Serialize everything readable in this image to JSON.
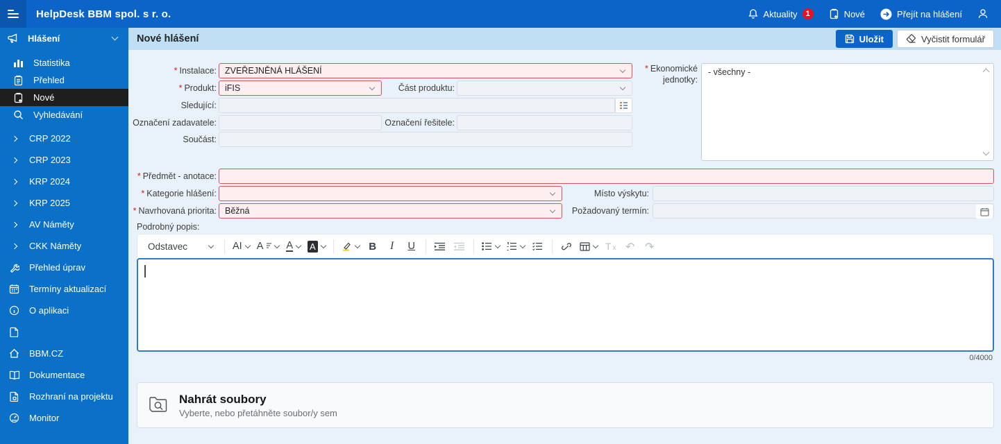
{
  "colors": {
    "brand": "#0d64c8",
    "hamburger": "#0b57b0",
    "sidebar-bg": "#0a70c8",
    "active-bg": "#1e1e1e",
    "header-bg": "#bfe0f4",
    "main-bg": "#e9f2fa",
    "req-border": "#d9545e",
    "req-bg": "#fdeef0",
    "field-bg": "#eff3f7",
    "field-border": "#d7dde3",
    "editor-border": "#2f7ad0",
    "badge": "#e81123"
  },
  "topbar": {
    "title": "HelpDesk BBM spol. s r. o.",
    "aktuality_label": "Aktuality",
    "aktuality_badge": "1",
    "nove_label": "Nové",
    "prejit_label": "Přejít na hlášení"
  },
  "sidebar": {
    "section_label": "Hlášení",
    "items": [
      {
        "label": "Statistika"
      },
      {
        "label": "Přehled"
      },
      {
        "label": "Nové"
      },
      {
        "label": "Vyhledávání"
      }
    ],
    "groups": [
      "CRP 2022",
      "CRP 2023",
      "KRP 2024",
      "KRP 2025",
      "AV Náměty",
      "CKK Náměty"
    ],
    "links": [
      {
        "label": "Přehled úprav"
      },
      {
        "label": "Termíny aktualizací"
      },
      {
        "label": "O aplikaci"
      },
      {
        "label": ""
      },
      {
        "label": "BBM.CZ"
      },
      {
        "label": "Dokumentace"
      },
      {
        "label": "Rozhraní na projektu"
      },
      {
        "label": "Monitor"
      }
    ]
  },
  "header": {
    "title": "Nové hlášení",
    "save_label": "Uložit",
    "clear_label": "Vyčistit formulář"
  },
  "form": {
    "required_marker": "*",
    "instalace_label": "Instalace:",
    "instalace_value": "ZVEŘEJNĚNÁ HLÁŠENÍ",
    "produkt_label": "Produkt:",
    "produkt_value": "iFIS",
    "cast_label": "Část produktu:",
    "sledujici_label": "Sledující:",
    "ozn_zadavatele_label": "Označení zadavatele:",
    "ozn_resitele_label": "Označení řešitele:",
    "soucast_label": "Součást:",
    "eko_label_line1": "Ekonomické",
    "eko_label_line2": "jednotky:",
    "eko_value": "- všechny -",
    "predmet_label": "Předmět - anotace:",
    "kategorie_label": "Kategorie hlášení:",
    "misto_label": "Místo výskytu:",
    "priorita_label": "Navrhovaná priorita:",
    "priorita_value": "Běžná",
    "termin_label": "Požadovaný termín:",
    "popis_label": "Podrobný popis:"
  },
  "editor": {
    "toolbar": {
      "paragraph": "Odstavec",
      "font_family": "AI",
      "font_size": "A",
      "text_color": "A",
      "bg_color": "A",
      "bold": "B",
      "italic": "I",
      "underline": "U",
      "clear_t": "T",
      "clear_x": "x",
      "undo": "↶",
      "redo": "↷"
    },
    "counter": "0/4000"
  },
  "upload": {
    "title": "Nahrát soubory",
    "subtitle": "Vyberte, nebo přetáhněte soubor/y sem"
  }
}
